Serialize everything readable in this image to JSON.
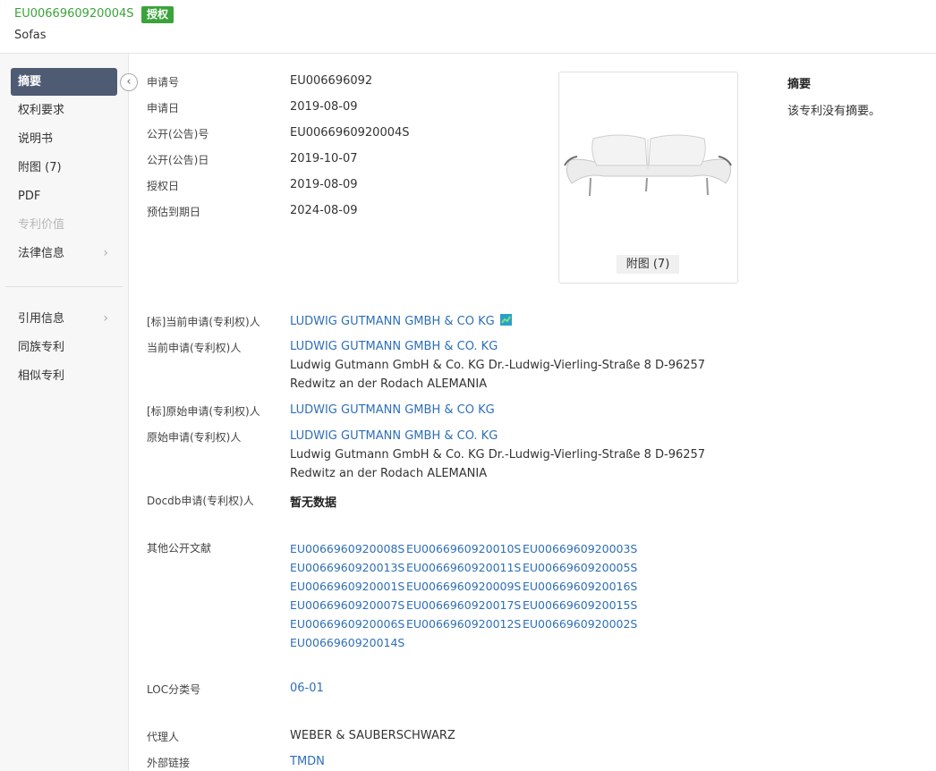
{
  "header": {
    "patent_id": "EU0066960920004S",
    "status_badge": "授权",
    "subtitle": "Sofas"
  },
  "sidebar": {
    "items": [
      {
        "label": "摘要",
        "state": "active"
      },
      {
        "label": "权利要求",
        "state": "normal"
      },
      {
        "label": "说明书",
        "state": "normal"
      },
      {
        "label": "附图 (7)",
        "state": "normal"
      },
      {
        "label": "PDF",
        "state": "normal"
      },
      {
        "label": "专利价值",
        "state": "disabled"
      },
      {
        "label": "法律信息",
        "state": "normal"
      }
    ],
    "items2": [
      {
        "label": "引用信息",
        "state": "normal"
      },
      {
        "label": "同族专利",
        "state": "normal"
      },
      {
        "label": "相似专利",
        "state": "normal"
      }
    ]
  },
  "biblio": {
    "application_number": {
      "label": "申请号",
      "value": "EU006696092"
    },
    "application_date": {
      "label": "申请日",
      "value": "2019-08-09"
    },
    "publication_number": {
      "label": "公开(公告)号",
      "value": "EU0066960920004S"
    },
    "publication_date": {
      "label": "公开(公告)日",
      "value": "2019-10-07"
    },
    "grant_date": {
      "label": "授权日",
      "value": "2019-08-09"
    },
    "expiry_date": {
      "label": "预估到期日",
      "value": "2024-08-09"
    }
  },
  "figure": {
    "caption": "附图 (7)"
  },
  "abstract": {
    "title": "摘要",
    "text": "该专利没有摘要。"
  },
  "applicants": {
    "std_current": {
      "label": "[标]当前申请(专利权)人",
      "value": "LUDWIG GUTMANN GMBH & CO KG"
    },
    "current": {
      "label": "当前申请(专利权)人",
      "name": "LUDWIG GUTMANN GMBH & CO. KG",
      "address_line1": "Ludwig Gutmann GmbH & Co. KG Dr.-Ludwig-Vierling-Straße 8 D-96257",
      "address_line2": "Redwitz an der Rodach ALEMANIA"
    },
    "std_original": {
      "label": "[标]原始申请(专利权)人",
      "value": "LUDWIG GUTMANN GMBH & CO KG"
    },
    "original": {
      "label": "原始申请(专利权)人",
      "name": "LUDWIG GUTMANN GMBH & CO. KG",
      "address_line1": "Ludwig Gutmann GmbH & Co. KG Dr.-Ludwig-Vierling-Straße 8 D-96257",
      "address_line2": "Redwitz an der Rodach ALEMANIA"
    },
    "docdb": {
      "label": "Docdb申请(专利权)人",
      "value": "暂无数据"
    }
  },
  "other_publications": {
    "label": "其他公开文献",
    "items": [
      "EU0066960920008S",
      "EU0066960920010S",
      "EU0066960920003S",
      "EU0066960920013S",
      "EU0066960920011S",
      "EU0066960920005S",
      "EU0066960920001S",
      "EU0066960920009S",
      "EU0066960920016S",
      "EU0066960920007S",
      "EU0066960920017S",
      "EU0066960920015S",
      "EU0066960920006S",
      "EU0066960920012S",
      "EU0066960920002S",
      "EU0066960920014S"
    ]
  },
  "loc": {
    "label": "LOC分类号",
    "value": "06-01"
  },
  "agent": {
    "label": "代理人",
    "value": "WEBER & SAUBERSCHWARZ"
  },
  "external_link": {
    "label": "外部链接",
    "value": "TMDN"
  },
  "colors": {
    "accent_green": "#3aa33a",
    "nav_active": "#4f5b73",
    "link_blue": "#2e6fb7"
  }
}
